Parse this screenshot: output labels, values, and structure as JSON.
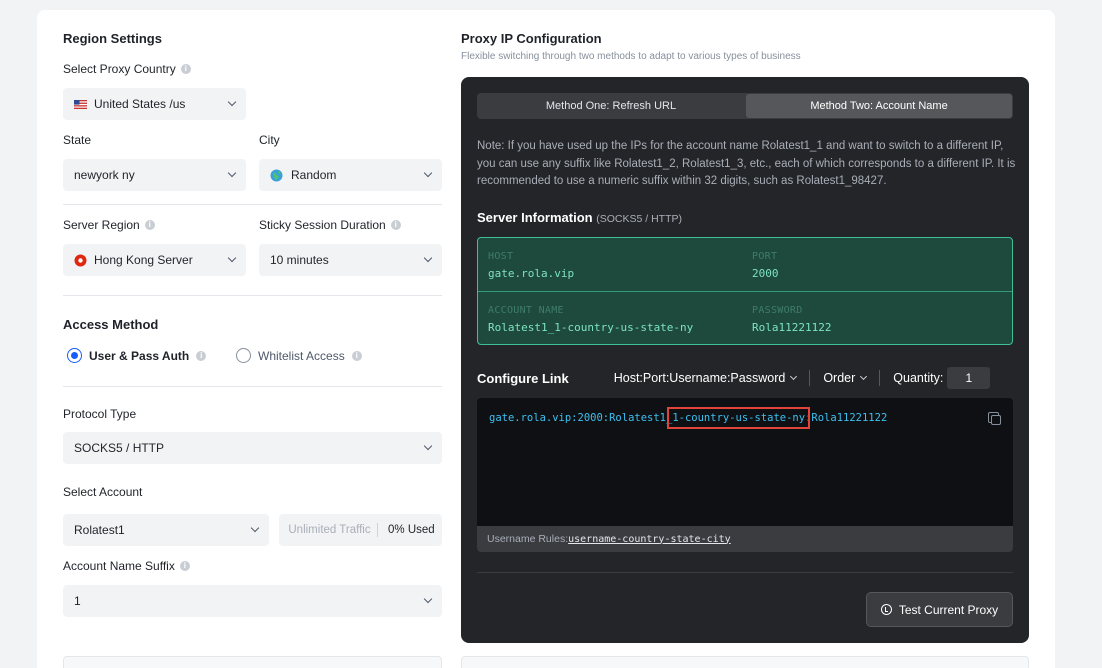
{
  "region": {
    "title": "Region Settings",
    "country_label": "Select Proxy Country",
    "country_value": "United States /us",
    "state_label": "State",
    "state_value": "newyork ny",
    "city_label": "City",
    "city_value": "Random",
    "server_region_label": "Server Region",
    "server_region_value": "Hong Kong Server",
    "sticky_label": "Sticky Session Duration",
    "sticky_value": "10 minutes"
  },
  "access": {
    "title": "Access Method",
    "option_user_pass": "User & Pass Auth",
    "option_whitelist": "Whitelist Access",
    "selected": "User & Pass Auth"
  },
  "protocol": {
    "label": "Protocol Type",
    "value": "SOCKS5 / HTTP"
  },
  "account": {
    "label": "Select Account",
    "value": "Rolatest1",
    "traffic_label": "Unlimited Traffic",
    "used_label": "0% Used",
    "suffix_label": "Account Name Suffix",
    "suffix_value": "1"
  },
  "proxy": {
    "title": "Proxy IP Configuration",
    "subtitle": "Flexible switching through two methods to adapt to various types of business",
    "tab_one": "Method One: Refresh URL",
    "tab_two": "Method Two: Account Name",
    "active_tab": "Method Two: Account Name",
    "note": "Note: If you have used up the IPs for the account name Rolatest1_1 and want to switch to a different IP, you can use any suffix like Rolatest1_2, Rolatest1_3, etc., each of which corresponds to a different IP. It is recommended to use a numeric suffix within 32 digits, such as Rolatest1_98427.",
    "server_info_title": "Server Information",
    "server_info_sub": "(SOCKS5 / HTTP)",
    "host_key": "HOST",
    "host_value": "gate.rola.vip",
    "port_key": "PORT",
    "port_value": "2000",
    "account_key": "ACCOUNT NAME",
    "account_value": "Rolatest1_1-country-us-state-ny",
    "password_key": "PASSWORD",
    "password_value": "Rola11221122",
    "configure_title": "Configure Link",
    "format_value": "Host:Port:Username:Password",
    "order_label": "Order",
    "quantity_label": "Quantity:",
    "quantity_value": "1",
    "link_pre": "gate.rola.vip:2000:Rolatest1_",
    "link_highlight": "1-country-us-state-ny",
    "link_post": ":Rola11221122",
    "rules_label": "Username Rules:",
    "rules_value": "username-country-state-city",
    "test_button": "Test Current Proxy"
  },
  "colors": {
    "accent": "#165dff",
    "dark_panel": "#232528",
    "server_box": "#1e4a3d",
    "highlight_border": "#e0443a"
  }
}
